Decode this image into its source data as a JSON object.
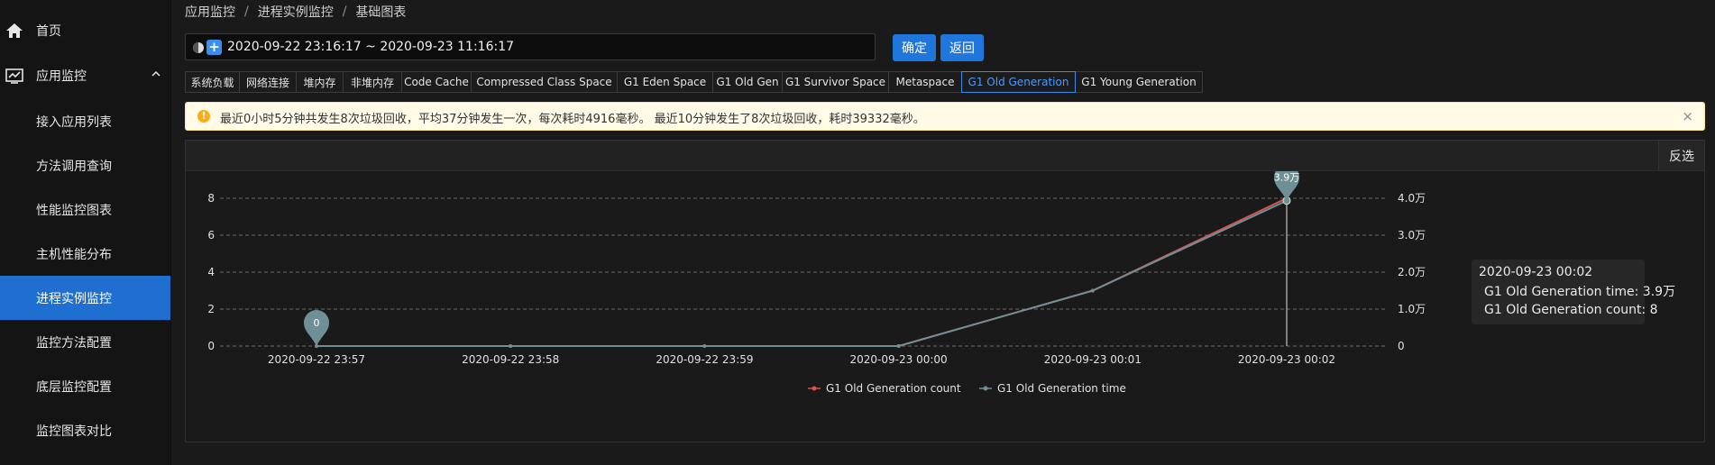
{
  "sidebar": {
    "items": [
      {
        "label": "首页",
        "icon": "home-icon"
      },
      {
        "label": "应用监控",
        "icon": "monitor-chart-icon"
      },
      {
        "label": "接入应用列表"
      },
      {
        "label": "方法调用查询"
      },
      {
        "label": "性能监控图表"
      },
      {
        "label": "主机性能分布"
      },
      {
        "label": "进程实例监控"
      },
      {
        "label": "监控方法配置"
      },
      {
        "label": "底层监控配置"
      },
      {
        "label": "监控图表对比"
      }
    ]
  },
  "breadcrumb": {
    "items": [
      "应用监控",
      "进程实例监控",
      "基础图表"
    ],
    "separator": "/"
  },
  "range": {
    "text": "2020-09-22 23:16:17 ~ 2020-09-23 11:16:17"
  },
  "buttons": {
    "confirm": "确定",
    "back": "返回"
  },
  "tabs": [
    "系统负载",
    "网络连接",
    "堆内存",
    "非堆内存",
    "Code Cache",
    "Compressed Class Space",
    "G1 Eden Space",
    "G1 Old Gen",
    "G1 Survivor Space",
    "Metaspace",
    "G1 Old Generation",
    "G1 Young Generation"
  ],
  "active_tab": "G1 Old Generation",
  "alert": {
    "text": "最近0小时5分钟共发生8次垃圾回收，平均37分钟发生一次，每次耗时4916毫秒。 最近10分钟发生了8次垃圾回收，耗时39332毫秒。",
    "close": "×"
  },
  "chart_header": {
    "invert": "反选"
  },
  "colors": {
    "accent": "#1f76dd",
    "count": "#d9534f",
    "time": "#6f8f96"
  },
  "chart_data": {
    "type": "line",
    "categories": [
      "2020-09-22 23:57",
      "2020-09-22 23:58",
      "2020-09-22 23:59",
      "2020-09-23 00:00",
      "2020-09-23 00:01",
      "2020-09-23 00:02"
    ],
    "x_ticks": [
      "2020-09-22 23:57",
      "2020-09-22 23:58",
      "2020-09-22 23:59",
      "2020-09-23 00:00",
      "2020-09-23 00:01",
      "2020-09-23 00:02"
    ],
    "y_left": {
      "ticks": [
        "0",
        "2",
        "4",
        "6",
        "8"
      ],
      "ylim": [
        0,
        8
      ]
    },
    "y_right": {
      "ticks": [
        "0",
        "1.0万",
        "2.0万",
        "3.0万",
        "4.0万"
      ],
      "ylim": [
        0,
        40000
      ]
    },
    "series": [
      {
        "name": "G1 Old Generation count",
        "axis": "left",
        "color": "#d9534f",
        "points": [
          [
            0,
            0
          ],
          [
            1,
            0
          ],
          [
            2,
            0
          ],
          [
            3,
            0
          ],
          [
            4,
            3
          ],
          [
            5,
            8
          ]
        ]
      },
      {
        "name": "G1 Old Generation time",
        "axis": "right",
        "color": "#6f8f96",
        "points": [
          [
            0,
            0
          ],
          [
            1,
            0
          ],
          [
            2,
            0
          ],
          [
            3,
            0
          ],
          [
            4,
            15000
          ],
          [
            5,
            39332
          ]
        ]
      }
    ],
    "markers": [
      {
        "label": "0",
        "index": 0
      },
      {
        "label": "3.9万",
        "index": 5
      }
    ],
    "grid": "dashed",
    "legend": "bottom-center",
    "tooltip": {
      "title": "2020-09-23 00:02",
      "rows": [
        "G1 Old Generation time: 3.9万",
        "G1 Old Generation count: 8"
      ]
    }
  }
}
